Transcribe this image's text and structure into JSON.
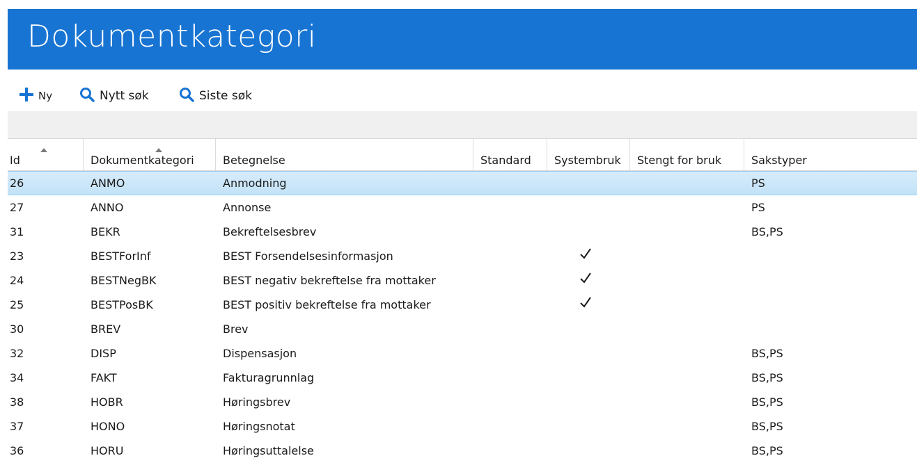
{
  "header": {
    "title": "Dokumentkategori"
  },
  "toolbar": {
    "new_label": "Ny",
    "new_search_label": "Nytt søk",
    "last_search_label": "Siste søk"
  },
  "colors": {
    "accent": "#1874d2",
    "selection": "#c9e5f8"
  },
  "grid": {
    "columns": [
      {
        "label": "Id",
        "sorted": true
      },
      {
        "label": "Dokumentkategori",
        "sorted": true
      },
      {
        "label": "Betegnelse",
        "sorted": false
      },
      {
        "label": "Standard",
        "sorted": false
      },
      {
        "label": "Systembruk",
        "sorted": false
      },
      {
        "label": "Stengt for bruk",
        "sorted": false
      },
      {
        "label": "Sakstyper",
        "sorted": false
      }
    ],
    "rows": [
      {
        "id": "26",
        "kategori": "ANMO",
        "betegnelse": "Anmodning",
        "systembruk": false,
        "sakstyper": "PS",
        "selected": true
      },
      {
        "id": "27",
        "kategori": "ANNO",
        "betegnelse": "Annonse",
        "systembruk": false,
        "sakstyper": "PS"
      },
      {
        "id": "31",
        "kategori": "BEKR",
        "betegnelse": "Bekreftelsesbrev",
        "systembruk": false,
        "sakstyper": "BS,PS"
      },
      {
        "id": "23",
        "kategori": "BESTForInf",
        "betegnelse": "BEST Forsendelsesinformasjon",
        "systembruk": true,
        "sakstyper": ""
      },
      {
        "id": "24",
        "kategori": "BESTNegBK",
        "betegnelse": "BEST negativ bekreftelse fra mottaker",
        "systembruk": true,
        "sakstyper": ""
      },
      {
        "id": "25",
        "kategori": "BESTPosBK",
        "betegnelse": "BEST positiv bekreftelse fra mottaker",
        "systembruk": true,
        "sakstyper": ""
      },
      {
        "id": "30",
        "kategori": "BREV",
        "betegnelse": "Brev",
        "systembruk": false,
        "sakstyper": ""
      },
      {
        "id": "32",
        "kategori": "DISP",
        "betegnelse": "Dispensasjon",
        "systembruk": false,
        "sakstyper": "BS,PS"
      },
      {
        "id": "34",
        "kategori": "FAKT",
        "betegnelse": "Fakturagrunnlag",
        "systembruk": false,
        "sakstyper": "BS,PS"
      },
      {
        "id": "38",
        "kategori": "HOBR",
        "betegnelse": "Høringsbrev",
        "systembruk": false,
        "sakstyper": "BS,PS"
      },
      {
        "id": "37",
        "kategori": "HONO",
        "betegnelse": "Høringsnotat",
        "systembruk": false,
        "sakstyper": "BS,PS"
      },
      {
        "id": "36",
        "kategori": "HORU",
        "betegnelse": "Høringsuttalelse",
        "systembruk": false,
        "sakstyper": "BS,PS"
      }
    ]
  }
}
